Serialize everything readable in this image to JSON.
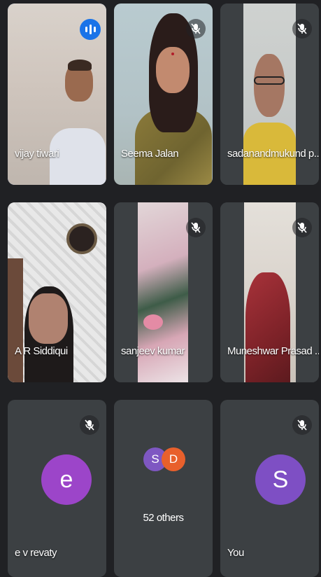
{
  "participants": [
    {
      "name": "vijay tiwari",
      "muted": false,
      "speaking": true
    },
    {
      "name": "Seema Jalan",
      "muted": true
    },
    {
      "name": "sadanandmukund p...",
      "muted": true
    },
    {
      "name": "A R Siddiqui",
      "muted": false
    },
    {
      "name": "sanjeev kumar",
      "muted": true
    },
    {
      "name": "Muneshwar Prasad ...",
      "muted": true
    },
    {
      "name": "e v revaty",
      "muted": true,
      "avatar_initial": "e",
      "avatar_color": "#9c45c9"
    },
    {
      "name": "You",
      "muted": true,
      "avatar_initial": "S",
      "avatar_color": "#7e4fc4"
    }
  ],
  "others": {
    "label": "52 others",
    "avatars": [
      {
        "initial": "S",
        "color": "#7e57c2"
      },
      {
        "initial": "D",
        "color": "#e8602c"
      }
    ]
  },
  "colors": {
    "background": "#202124",
    "tile": "#3c4043",
    "active_border": "#8ab4f8",
    "speaking_badge": "#1a73e8"
  }
}
